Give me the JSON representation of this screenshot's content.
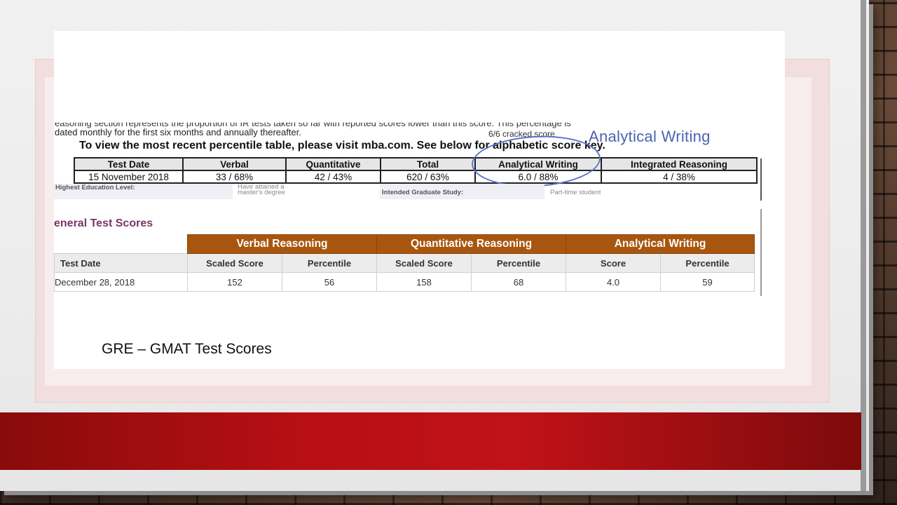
{
  "gmat": {
    "note_line_1": "easoning section represents the proportion of IR tests taken so far with reported scores lower than this score. This percentage is",
    "note_line_2": "dated monthly for the first six months and annually thereafter.",
    "cracked_note": "6/6 cracked score",
    "handwritten_label": "Analytical Writing",
    "visit_line": "To view the most recent percentile table, please visit mba.com. See below for alphabetic score key.",
    "headers": [
      "Test Date",
      "Verbal",
      "Quantitative",
      "Total",
      "Analytical Writing",
      "Integrated Reasoning"
    ],
    "row": [
      "15 November 2018",
      "33 / 68%",
      "42 / 43%",
      "620 / 63%",
      "6.0 / 88%",
      "4 / 38%"
    ],
    "faded": {
      "label_1": "Highest Education Level:",
      "value_1a": "Have attained a",
      "value_1b": "master's degree",
      "label_2": "Intended Graduate Study:",
      "value_2": "Part-time student"
    }
  },
  "gre": {
    "title": "eneral Test Scores",
    "groups": [
      "Verbal Reasoning",
      "Quantitative Reasoning",
      "Analytical Writing"
    ],
    "subheaders": [
      "Test Date",
      "Scaled Score",
      "Percentile",
      "Scaled Score",
      "Percentile",
      "Score",
      "Percentile"
    ],
    "row": [
      "December 28, 2018",
      "152",
      "56",
      "158",
      "68",
      "4.0",
      "59"
    ]
  },
  "caption": "GRE – GMAT Test Scores",
  "colors": {
    "accent_red": "#b70f14",
    "gre_header_brown": "#a8560f",
    "gre_title_purple": "#7a3566",
    "handwriting_blue": "#4a63b0"
  }
}
